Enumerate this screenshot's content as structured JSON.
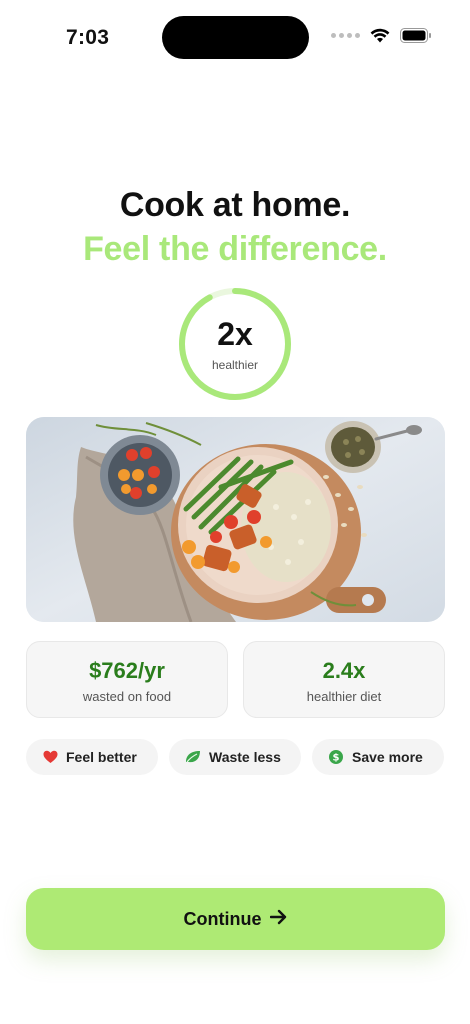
{
  "status_bar": {
    "time": "7:03"
  },
  "title": "Cook at home.",
  "subtitle": "Feel the difference.",
  "ring": {
    "value": "2x",
    "label": "healthier",
    "progress": 0.92,
    "accent": "#a9e87a"
  },
  "stats": [
    {
      "value": "$762/yr",
      "label": "wasted on food"
    },
    {
      "value": "2.4x",
      "label": "healthier diet"
    }
  ],
  "chips": [
    {
      "label": "Feel better",
      "icon": "heart-icon",
      "color": "#e53935"
    },
    {
      "label": "Waste less",
      "icon": "leaf-icon",
      "color": "#3aa64a"
    },
    {
      "label": "Save more",
      "icon": "dollar-coin-icon",
      "color": "#3aa64a"
    }
  ],
  "cta": {
    "label": "Continue",
    "icon": "arrow-right-icon",
    "color": "#aeea74"
  },
  "colors": {
    "accent_green": "#a9e87a",
    "stat_green": "#2a7d1c"
  }
}
